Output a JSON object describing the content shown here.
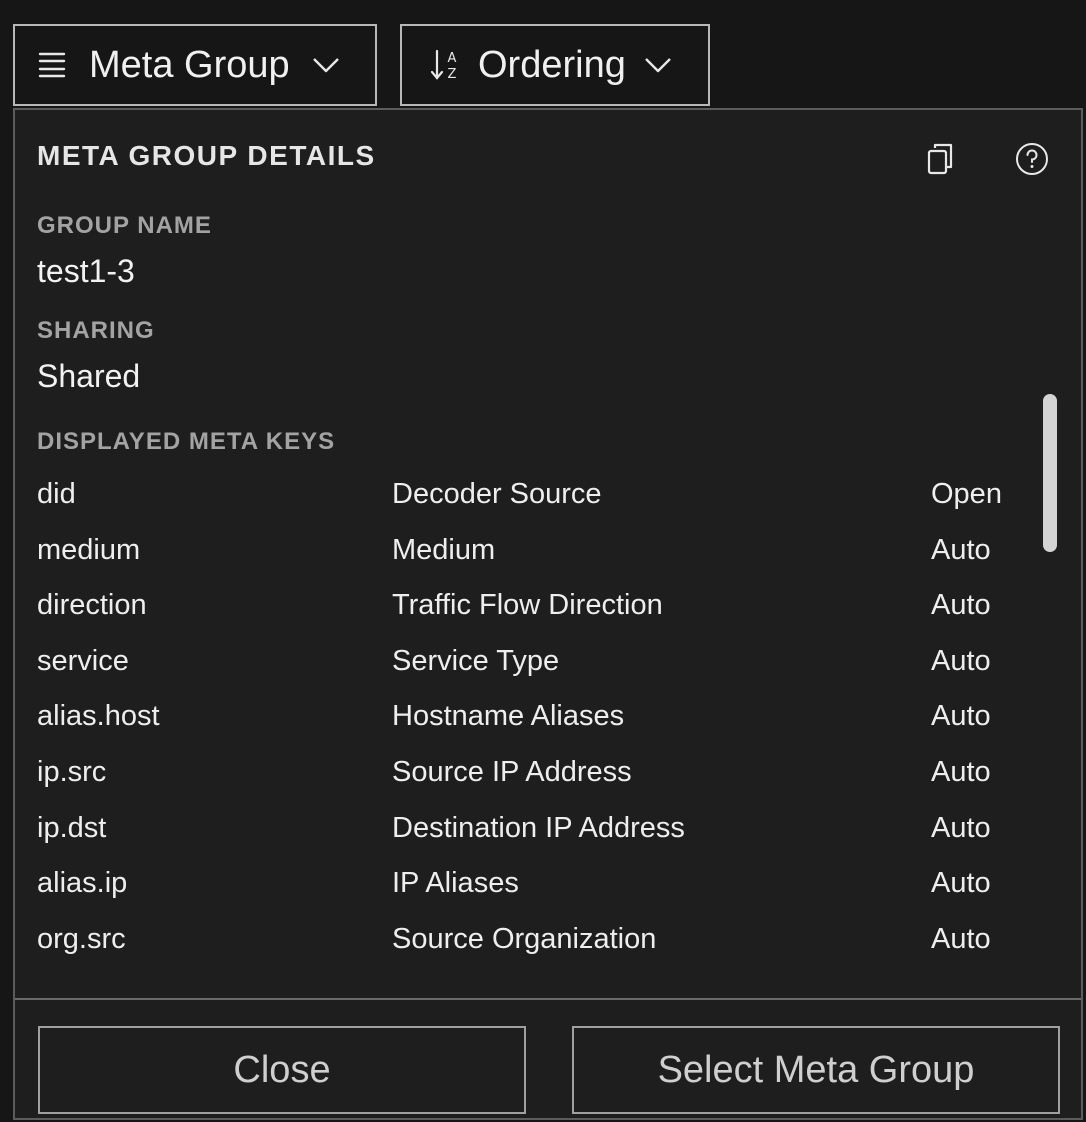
{
  "toolbar": {
    "meta_group": {
      "label": "Meta Group",
      "icon": "stacked-lines-icon",
      "chevron": "chevron-down-icon"
    },
    "ordering": {
      "label": "Ordering",
      "icon": "sort-az-icon",
      "sort_glyph_a": "A",
      "sort_glyph_z": "Z",
      "chevron": "chevron-down-icon"
    }
  },
  "panel": {
    "title": "META GROUP DETAILS",
    "icons": {
      "copy": "copy-icon",
      "help": "help-icon"
    },
    "group_name": {
      "label": "GROUP NAME",
      "value": "test1-3"
    },
    "sharing": {
      "label": "SHARING",
      "value": "Shared"
    },
    "displayed_meta_keys": {
      "label": "DISPLAYED META KEYS",
      "rows": [
        {
          "key": "did",
          "description": "Decoder Source",
          "mode": "Open"
        },
        {
          "key": "medium",
          "description": "Medium",
          "mode": "Auto"
        },
        {
          "key": "direction",
          "description": "Traffic Flow Direction",
          "mode": "Auto"
        },
        {
          "key": "service",
          "description": "Service Type",
          "mode": "Auto"
        },
        {
          "key": "alias.host",
          "description": "Hostname Aliases",
          "mode": "Auto"
        },
        {
          "key": "ip.src",
          "description": "Source IP Address",
          "mode": "Auto"
        },
        {
          "key": "ip.dst",
          "description": "Destination IP Address",
          "mode": "Auto"
        },
        {
          "key": "alias.ip",
          "description": "IP Aliases",
          "mode": "Auto"
        },
        {
          "key": "org.src",
          "description": "Source Organization",
          "mode": "Auto"
        }
      ]
    }
  },
  "footer": {
    "close_label": "Close",
    "select_label": "Select Meta Group"
  },
  "colors": {
    "background": "#161616",
    "panel": "#1e1e1e",
    "label_gray": "#a3a3a3",
    "text": "#f0f0f0"
  }
}
